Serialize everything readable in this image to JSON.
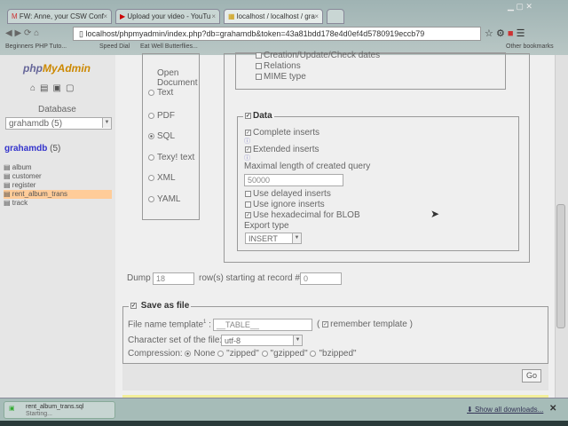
{
  "browser": {
    "tabs": [
      {
        "label": "FW: Anne, your CSW Conf"
      },
      {
        "label": "Upload your video - YouTu"
      },
      {
        "label": "localhost / localhost / gra"
      }
    ],
    "url": "localhost/phpmyadmin/index.php?db=grahamdb&token=43a81bdd178e4d0ef4d5780919eccb79",
    "bookmarks": [
      "Beginners PHP Tuto...",
      "Speed Dial",
      "Eat Well Butterflies..."
    ],
    "other_bookmarks": "Other bookmarks"
  },
  "sidebar": {
    "logo": "phpMyAdmin",
    "database_label": "Database",
    "database_select": "grahamdb (5)",
    "db_name": "grahamdb",
    "db_count": "(5)",
    "tables": [
      "album",
      "customer",
      "register",
      "rent_album_trans",
      "track"
    ],
    "highlight_color": "#ffcc99"
  },
  "formats": [
    "Open Document Text",
    "PDF",
    "SQL",
    "Texy! text",
    "XML",
    "YAML"
  ],
  "selected_format": "SQL",
  "structure": {
    "items": [
      "Creation/Update/Check dates",
      "Relations",
      "MIME type"
    ]
  },
  "data_section": {
    "title": "Data",
    "complete_inserts": "Complete inserts",
    "extended_inserts": "Extended inserts",
    "max_length_label": "Maximal length of created query",
    "max_length_value": "50000",
    "delayed": "Use delayed inserts",
    "ignore": "Use ignore inserts",
    "hex": "Use hexadecimal for BLOB",
    "export_type_label": "Export type",
    "export_type": "INSERT"
  },
  "dump": {
    "label": "Dump",
    "rows": "18",
    "mid": "row(s) starting at record #",
    "start": "0"
  },
  "save": {
    "title": "Save as file",
    "filename_label": "File name template",
    "sup": "1",
    "filename": "__TABLE__",
    "remember": "remember template",
    "paren_open": "(",
    "paren_close": ")",
    "charset_label": "Character set of the file:",
    "charset": "utf-8",
    "compression_label": "Compression:",
    "compression_options": [
      "None",
      "\"zipped\"",
      "\"gzipped\"",
      "\"bzipped\""
    ],
    "go": "Go"
  },
  "downloads": {
    "file": "rent_album_trans.sql",
    "status": "Starting...",
    "show_all": "Show all downloads..."
  }
}
